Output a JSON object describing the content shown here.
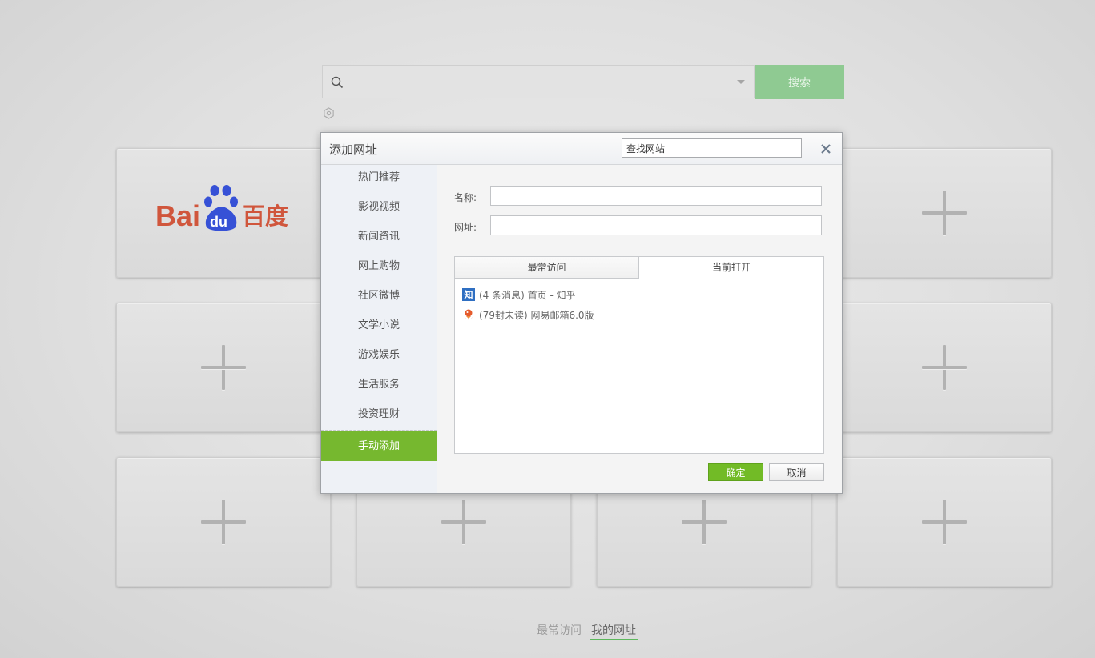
{
  "search": {
    "placeholder": "",
    "button_label": "搜索"
  },
  "tiles": [
    {
      "type": "site",
      "name": "百度",
      "logo_text": "Bai",
      "logo_du": "du",
      "logo_cn": "百度"
    },
    {
      "type": "empty"
    },
    {
      "type": "empty"
    },
    {
      "type": "empty"
    },
    {
      "type": "empty"
    },
    {
      "type": "empty"
    },
    {
      "type": "empty"
    },
    {
      "type": "empty"
    },
    {
      "type": "empty"
    },
    {
      "type": "empty"
    },
    {
      "type": "empty"
    },
    {
      "type": "empty"
    }
  ],
  "footer": {
    "tabs": [
      "最常访问",
      "我的网址"
    ],
    "active": "我的网址"
  },
  "dialog": {
    "title": "添加网址",
    "site_search_value": "查找网站",
    "categories": [
      "热门推荐",
      "影视视频",
      "新闻资讯",
      "网上购物",
      "社区微博",
      "文学小说",
      "游戏娱乐",
      "生活服务",
      "投资理财",
      "手动添加"
    ],
    "active_category": "手动添加",
    "form": {
      "name_label": "名称:",
      "url_label": "网址:",
      "name_value": "",
      "url_value": ""
    },
    "panel_tabs": [
      "最常访问",
      "当前打开"
    ],
    "active_panel_tab": "当前打开",
    "open_pages": [
      {
        "title": "(4 条消息) 首页 - 知乎",
        "icon": "zhihu-icon",
        "icon_text": "知"
      },
      {
        "title": "(79封未读) 网易邮箱6.0版",
        "icon": "netease-mail-icon"
      }
    ],
    "confirm_label": "确定",
    "cancel_label": "取消"
  },
  "colors": {
    "accent_green": "#76b82f",
    "search_button": "#8fca92",
    "baidu_red": "#d0563c",
    "baidu_blue": "#3651d6"
  }
}
